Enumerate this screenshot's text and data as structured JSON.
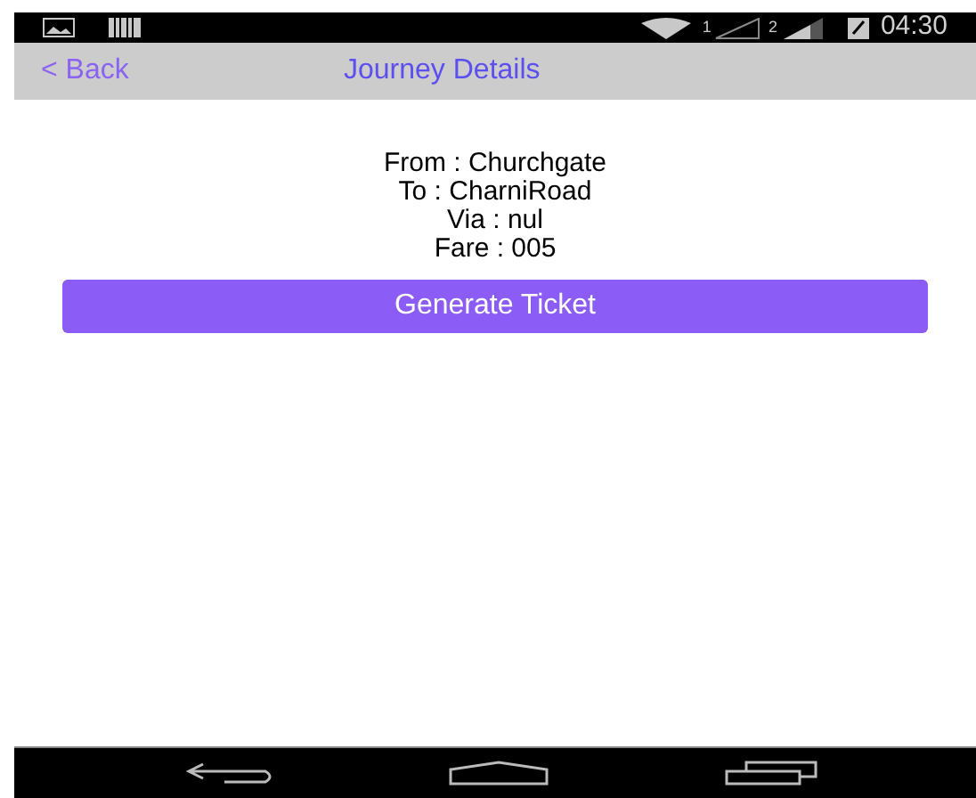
{
  "status_bar": {
    "sim_1": "1",
    "sim_2": "2",
    "time": "04:30"
  },
  "nav_bar": {
    "back": "< Back",
    "title": "Journey Details"
  },
  "details": [
    "From : Churchgate",
    "To : CharniRoad",
    "Via : nul",
    "Fare : 005"
  ],
  "button": "Generate Ticket"
}
